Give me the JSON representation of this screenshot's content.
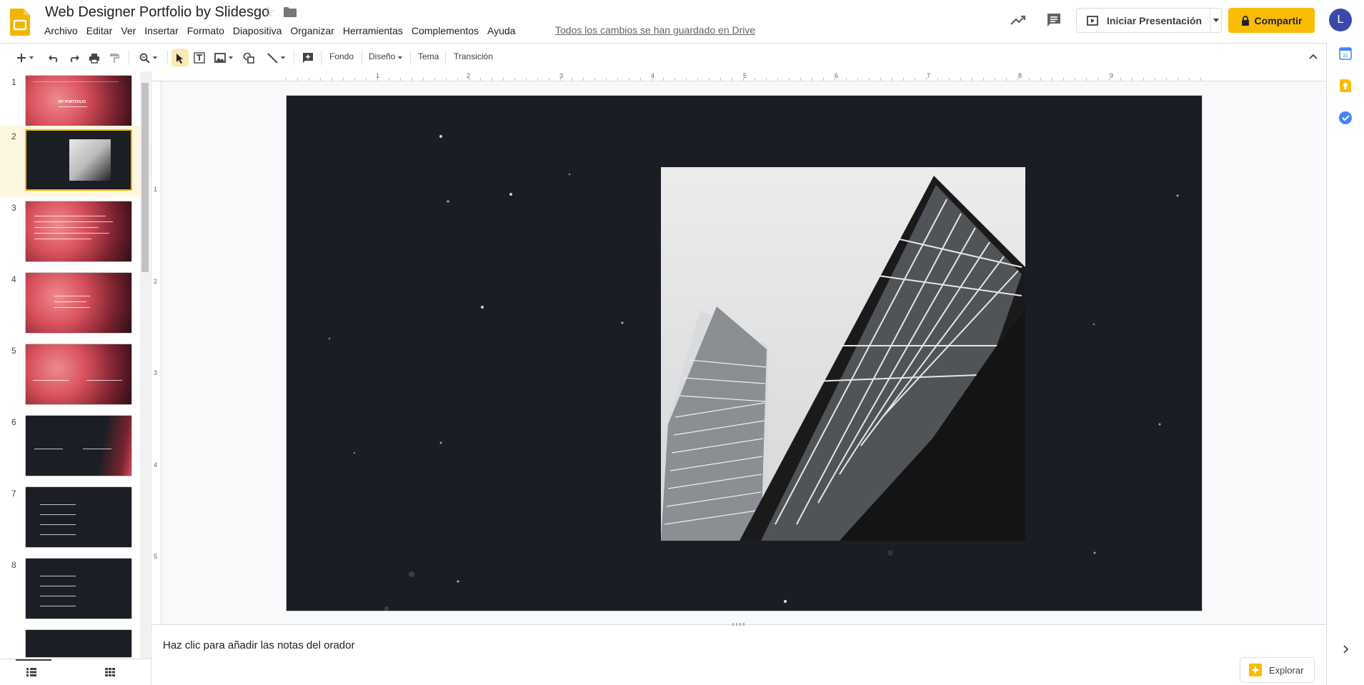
{
  "header": {
    "title": "Web Designer Portfolio by Slidesgo",
    "save_status": "Todos los cambios se han guardado en Drive",
    "present_label": "Iniciar Presentación",
    "share_label": "Compartir",
    "avatar_initial": "L"
  },
  "menu": [
    "Archivo",
    "Editar",
    "Ver",
    "Insertar",
    "Formato",
    "Diapositiva",
    "Organizar",
    "Herramientas",
    "Complementos",
    "Ayuda"
  ],
  "toolbar": {
    "background": "Fondo",
    "layout": "Diseño",
    "theme": "Tema",
    "transition": "Transición"
  },
  "slides": [
    {
      "number": "1",
      "theme": "red",
      "title": "MY PORTFOLIO"
    },
    {
      "number": "2",
      "theme": "dark",
      "selected": true
    },
    {
      "number": "3",
      "theme": "red"
    },
    {
      "number": "4",
      "theme": "red"
    },
    {
      "number": "5",
      "theme": "red"
    },
    {
      "number": "6",
      "theme": "darkred"
    },
    {
      "number": "7",
      "theme": "dark"
    },
    {
      "number": "8",
      "theme": "dark"
    }
  ],
  "ruler": {
    "horizontal": [
      "1",
      "2",
      "3",
      "4",
      "5",
      "6",
      "7",
      "8",
      "9"
    ],
    "vertical": [
      "1",
      "2",
      "3",
      "4",
      "5"
    ]
  },
  "notes": {
    "placeholder": "Haz clic para añadir las notas del orador"
  },
  "explore_label": "Explorar",
  "colors": {
    "accent": "#fbbc04",
    "slide_bg": "#1a1d23",
    "avatar": "#3949ab"
  }
}
